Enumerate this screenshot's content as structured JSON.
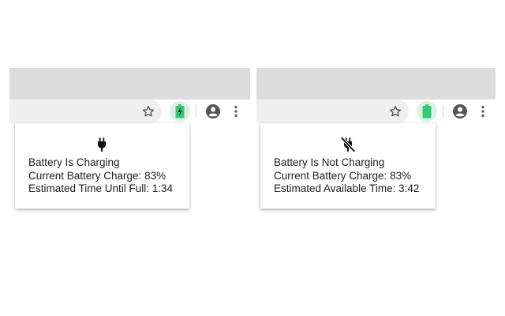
{
  "colors": {
    "tabstrip": "#dddddd",
    "omnibox": "#efefef",
    "battery_green": "#2ecc71",
    "extension_highlight": "#e2eee4"
  },
  "panels": [
    {
      "toolbar": {
        "star_icon": "star-icon",
        "extension_icon": "battery-charging-icon",
        "account_icon": "account-circle-icon",
        "menu_icon": "kebab-menu-icon"
      },
      "popup": {
        "status_icon": "plug-icon",
        "status_line": "Battery Is Charging",
        "charge_line": "Current Battery Charge: 83%",
        "time_line": "Estimated Time Until Full: 1:34"
      }
    },
    {
      "toolbar": {
        "star_icon": "star-icon",
        "extension_icon": "battery-icon",
        "account_icon": "account-circle-icon",
        "menu_icon": "kebab-menu-icon"
      },
      "popup": {
        "status_icon": "plug-off-icon",
        "status_line": "Battery Is Not Charging",
        "charge_line": "Current Battery Charge: 83%",
        "time_line": "Estimated Available Time: 3:42"
      }
    }
  ]
}
